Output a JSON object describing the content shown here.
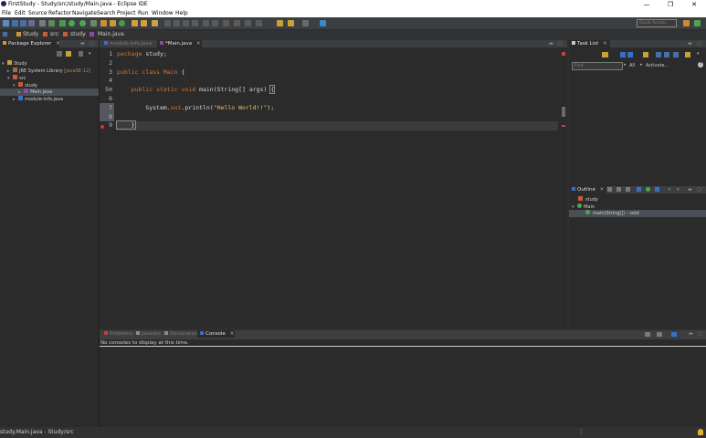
{
  "window": {
    "title": "FirstStudy - Study/src/study/Main.java - Eclipse IDE",
    "minimize": "—",
    "maximize": "❐",
    "close": "✕"
  },
  "menu": [
    "File",
    "Edit",
    "Source",
    "Refactor",
    "Navigate",
    "Search",
    "Project",
    "Run",
    "Window",
    "Help"
  ],
  "toolbar": {
    "quick_access_placeholder": "Quick Access"
  },
  "breadcrumb": [
    "Study",
    "src",
    "study",
    "Main.java"
  ],
  "package_explorer": {
    "title": "Package Explorer",
    "tree": [
      {
        "label": "Study",
        "level": 0,
        "twisty": "▾",
        "icon": "project-icon"
      },
      {
        "label": "JRE System Library",
        "extra": "[JavaSE-12]",
        "level": 1,
        "twisty": "▸",
        "icon": "library-icon"
      },
      {
        "label": "src",
        "level": 1,
        "twisty": "▾",
        "icon": "source-folder-icon"
      },
      {
        "label": "study",
        "level": 2,
        "twisty": "▾",
        "icon": "package-icon"
      },
      {
        "label": "Main.java",
        "level": 3,
        "twisty": "▸",
        "icon": "java-file-icon",
        "selected": true
      },
      {
        "label": "module-info.java",
        "level": 2,
        "twisty": "▸",
        "icon": "java-file-icon"
      }
    ]
  },
  "editor": {
    "tabs": [
      {
        "label": "module-info.java",
        "active": false
      },
      {
        "label": "*Main.java",
        "active": true
      }
    ],
    "lines": [
      {
        "n": "1",
        "code": [
          {
            "t": "package",
            "c": "kw"
          },
          {
            "t": " study;",
            "c": ""
          }
        ]
      },
      {
        "n": "2",
        "code": []
      },
      {
        "n": "3",
        "code": [
          {
            "t": "public",
            "c": "kw"
          },
          {
            "t": " ",
            "c": ""
          },
          {
            "t": "class",
            "c": "kw"
          },
          {
            "t": " ",
            "c": ""
          },
          {
            "t": "Main",
            "c": "cls"
          },
          {
            "t": " {",
            "c": ""
          }
        ]
      },
      {
        "n": "4",
        "code": []
      },
      {
        "n": "5⊖",
        "code": [
          {
            "t": "    ",
            "c": ""
          },
          {
            "t": "public",
            "c": "kw"
          },
          {
            "t": " ",
            "c": ""
          },
          {
            "t": "static",
            "c": "kw"
          },
          {
            "t": " ",
            "c": ""
          },
          {
            "t": "void",
            "c": "kw"
          },
          {
            "t": " main(String[] args) ",
            "c": ""
          },
          {
            "t": "{",
            "c": "brace"
          }
        ]
      },
      {
        "n": "6",
        "code": []
      },
      {
        "n": "7",
        "code": [
          {
            "t": "        System.",
            "c": ""
          },
          {
            "t": "out",
            "c": "kw"
          },
          {
            "t": ".println(",
            "c": ""
          },
          {
            "t": "\"Hello World!!\"",
            "c": "str"
          },
          {
            "t": ");",
            "c": ""
          }
        ]
      },
      {
        "n": "8",
        "code": []
      },
      {
        "n": "9",
        "code": [
          {
            "t": "    }",
            "c": "brace"
          }
        ]
      }
    ]
  },
  "task_list": {
    "title": "Task List",
    "search_placeholder": "Find",
    "all_label": "All",
    "activate_label": "Activate..."
  },
  "outline": {
    "title": "Outline",
    "items": [
      {
        "label": "study",
        "level": 0,
        "icon": "package-icon"
      },
      {
        "label": "Main",
        "level": 0,
        "twisty": "▾",
        "icon": "class-icon"
      },
      {
        "label": "main(String[]) : void",
        "level": 1,
        "icon": "method-icon",
        "selected": true
      }
    ]
  },
  "bottom_panel": {
    "tabs": [
      {
        "label": "Problems",
        "active": false
      },
      {
        "label": "Javadoc",
        "active": false
      },
      {
        "label": "Declaration",
        "active": false
      },
      {
        "label": "Console",
        "active": true
      }
    ],
    "message": "No consoles to display at this time."
  },
  "status_bar": {
    "text": "study.Main.java - Study/src"
  },
  "colors": {
    "background": "#2b2b2b",
    "keyword": "#cc7832",
    "class_name": "#e36d3a",
    "string": "#f0c05a",
    "selection": "#4a4f55"
  }
}
